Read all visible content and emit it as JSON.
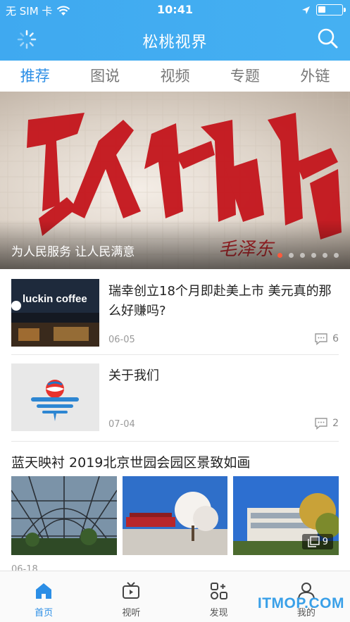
{
  "status_bar": {
    "carrier": "无 SIM 卡",
    "time": "10:41"
  },
  "nav": {
    "title": "松桃视界"
  },
  "tabs": [
    {
      "label": "推荐",
      "active": true
    },
    {
      "label": "图说",
      "active": false
    },
    {
      "label": "视频",
      "active": false
    },
    {
      "label": "专题",
      "active": false
    },
    {
      "label": "外链",
      "active": false
    }
  ],
  "banner": {
    "caption": "为人民服务 让人民满意",
    "image_text": "为人民服务",
    "slide_count": 6,
    "active_slide": 0
  },
  "news": [
    {
      "title": "瑞幸创立18个月即赴美上市 美元真的那么好赚吗?",
      "date": "06-05",
      "comments": "6",
      "thumb_text": "luckin coffee"
    },
    {
      "title": "关于我们",
      "date": "07-04",
      "comments": "2"
    }
  ],
  "gallery": {
    "title": "蓝天映衬 2019北京世园会园区景致如画",
    "date": "06-18",
    "image_count": "9"
  },
  "tabbar": [
    {
      "label": "首页",
      "icon": "home-icon",
      "active": true
    },
    {
      "label": "视听",
      "icon": "tv-icon",
      "active": false
    },
    {
      "label": "发现",
      "icon": "discover-icon",
      "active": false
    },
    {
      "label": "我的",
      "icon": "profile-icon",
      "active": false
    }
  ],
  "watermark": "ITMOP.COM",
  "colors": {
    "header": "#42adf1",
    "accent": "#2b8ee6",
    "dot_active": "#ff5a3c"
  }
}
